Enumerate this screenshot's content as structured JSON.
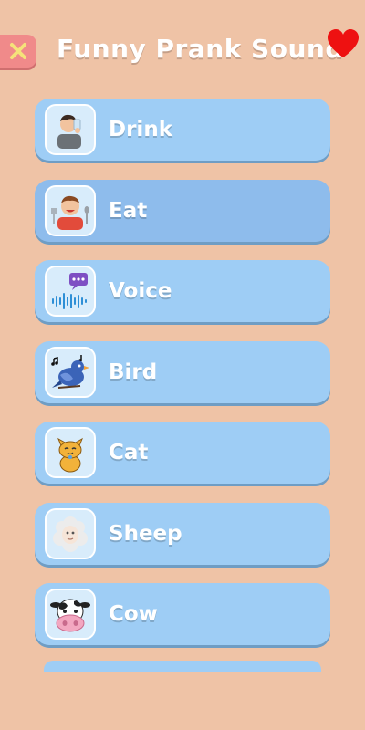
{
  "header": {
    "title": "Funny Prank Sound",
    "close_icon": "close-icon",
    "favorite_icon": "heart-icon",
    "colors": {
      "background": "#efc3a6",
      "close_button": "#f08a8a",
      "heart": "#e11"
    }
  },
  "items": [
    {
      "label": "Drink",
      "icon": "drink-icon",
      "selected": false
    },
    {
      "label": "Eat",
      "icon": "eat-icon",
      "selected": true
    },
    {
      "label": "Voice",
      "icon": "voice-icon",
      "selected": false
    },
    {
      "label": "Bird",
      "icon": "bird-icon",
      "selected": false
    },
    {
      "label": "Cat",
      "icon": "cat-icon",
      "selected": false
    },
    {
      "label": "Sheep",
      "icon": "sheep-icon",
      "selected": false
    },
    {
      "label": "Cow",
      "icon": "cow-icon",
      "selected": false
    }
  ],
  "colors": {
    "card": "#9ecdf5",
    "card_shadow": "#6f9dc4",
    "card_selected": "#8ebcec"
  }
}
